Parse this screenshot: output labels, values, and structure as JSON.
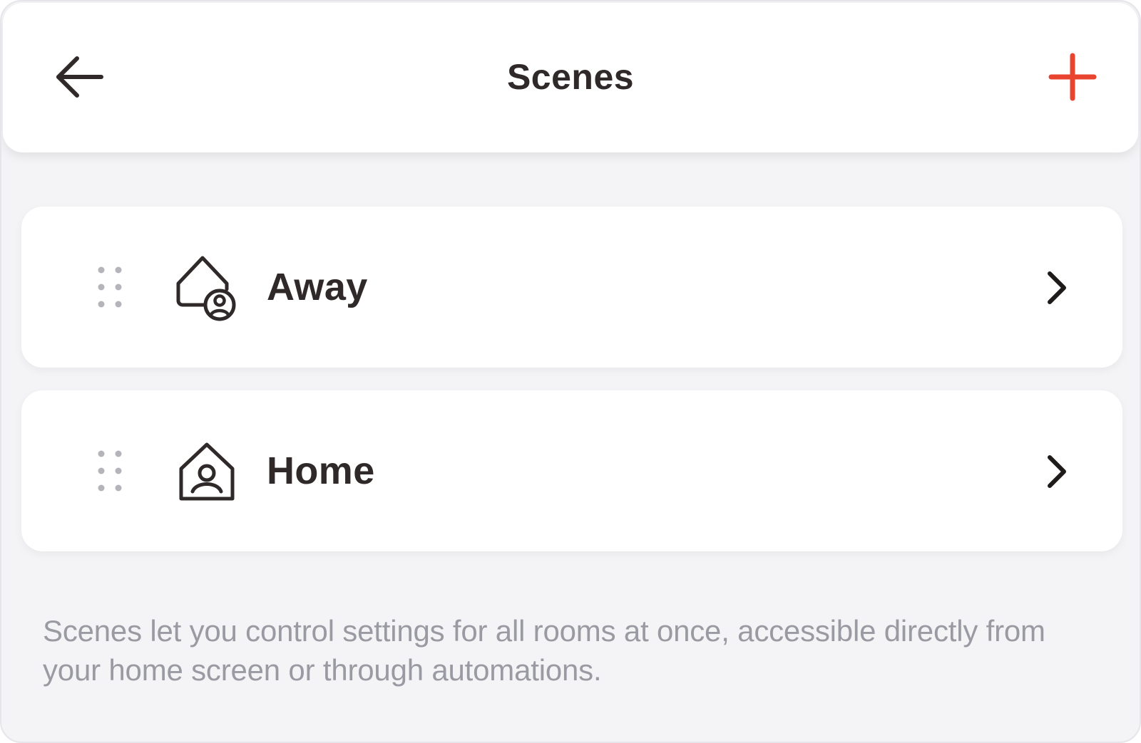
{
  "header": {
    "title": "Scenes",
    "back_icon": "arrow-left-icon",
    "add_icon": "plus-icon"
  },
  "scenes": [
    {
      "label": "Away",
      "icon": "house-with-person-badge-icon",
      "drag_icon": "drag-handle-icon",
      "chevron_icon": "chevron-right-icon"
    },
    {
      "label": "Home",
      "icon": "house-person-icon",
      "drag_icon": "drag-handle-icon",
      "chevron_icon": "chevron-right-icon"
    }
  ],
  "description": "Scenes let you control settings for all rooms at once, accessible directly from your home screen or through automations.",
  "colors": {
    "background": "#f4f4f6",
    "card": "#ffffff",
    "text_primary": "#2f2a29",
    "text_muted": "#9a9aa2",
    "accent": "#e8442f",
    "drag_dots": "#b4b4ba"
  }
}
